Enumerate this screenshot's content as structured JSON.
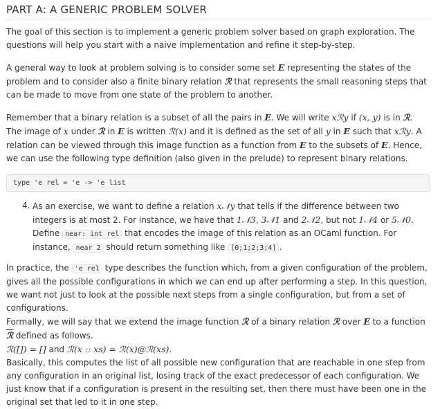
{
  "section": {
    "title": "PART A: A GENERIC PROBLEM SOLVER"
  },
  "p1": {
    "text": "The goal of this section is to implement a generic problem solver based on graph exploration. The questions will help you start with a naive implementation and refine it step-by-step."
  },
  "p2": {
    "a": "A general way to look at problem solving is to consider some set ",
    "E": "E",
    "b": " representing the states of the problem and to consider also a finite binary relation ",
    "R": "ℛ",
    "c": " that represents the small reasoning steps that can be made to move from one state of the problem to another."
  },
  "p3": {
    "a": "Remember that a binary relation is a subset of all the pairs in ",
    "E1": "E",
    "b": ". We will write ",
    "xRy": "xℛy",
    "c": " if ",
    "pair": "(x, y)",
    "d": " is in ",
    "R1": "ℛ",
    "e": ". The image of ",
    "x1": "x",
    "f": " under ",
    "R2": "ℛ",
    "g": " in ",
    "E2": "E",
    "h": " is written ",
    "Rx": "ℛ(x)",
    "i": " and it is defined as the set of all ",
    "y1": "y",
    "j": " in ",
    "E3": "E",
    "k": " such that ",
    "xRy2": "xℛy",
    "l": ". A relation can be viewed through this image function as a function from ",
    "E4": "E",
    "m": " to the subsets of ",
    "E5": "E",
    "n": ". Hence, we can use the following type definition (also given in the prelude) to represent binary relations."
  },
  "code_block": {
    "text": "type 'e rel = 'e -> 'e list"
  },
  "exercise": {
    "number": "4.",
    "a": "As an exercise, we want to define a relation ",
    "xNy": "x𝒩y",
    "b": " that tells if the difference between two integers is at most 2. For instance, we have that ",
    "ex1": "1𝒩3",
    "sep1": ", ",
    "ex2": "3𝒩1",
    "c": " and ",
    "ex3": "2𝒩2",
    "d": ", but not ",
    "ex4": "1𝒩4",
    "e": " or ",
    "ex5": "5𝒩0",
    "f": ".",
    "g": "Define ",
    "code1": "near: int rel",
    "h": " that encodes the image of this relation as an OCaml function. For instance, ",
    "code2": "near 2",
    "i": " should return something like ",
    "code3": "[0;1;2;3;4]",
    "j": "."
  },
  "p4": {
    "a": "In practice, the ",
    "code": "'e rel",
    "b": " type describes the function which, from a given configuration of the problem, gives all the possible configurations in which we can end up after performing a step. In this question, we want not just to look at the possible next steps from a single configuration, but from a set of configurations.",
    "c": "Formally, we will say that we extend the image function ",
    "R1": "ℛ",
    "d": " of a binary relation ",
    "R2": "ℛ",
    "e": " over ",
    "E": "E",
    "f": " to a function ",
    "Rbar": "ℛ",
    "g": " defined as follows."
  },
  "formula": {
    "lhs1": "ℛ([]) = []",
    "and": " and ",
    "lhs2": "ℛ(x :: xs) = ℛ(x)@ℛ(xs)",
    "period": "."
  },
  "p5": {
    "text": "Basically, this computes the list of all possible new configuration that are reachable in one step from any configuration in an original list, losing track of the exact predecessor of each configuration. We just know that if a configuration is present in the resulting set, then there must have been one in the original set that led to it in one step."
  }
}
